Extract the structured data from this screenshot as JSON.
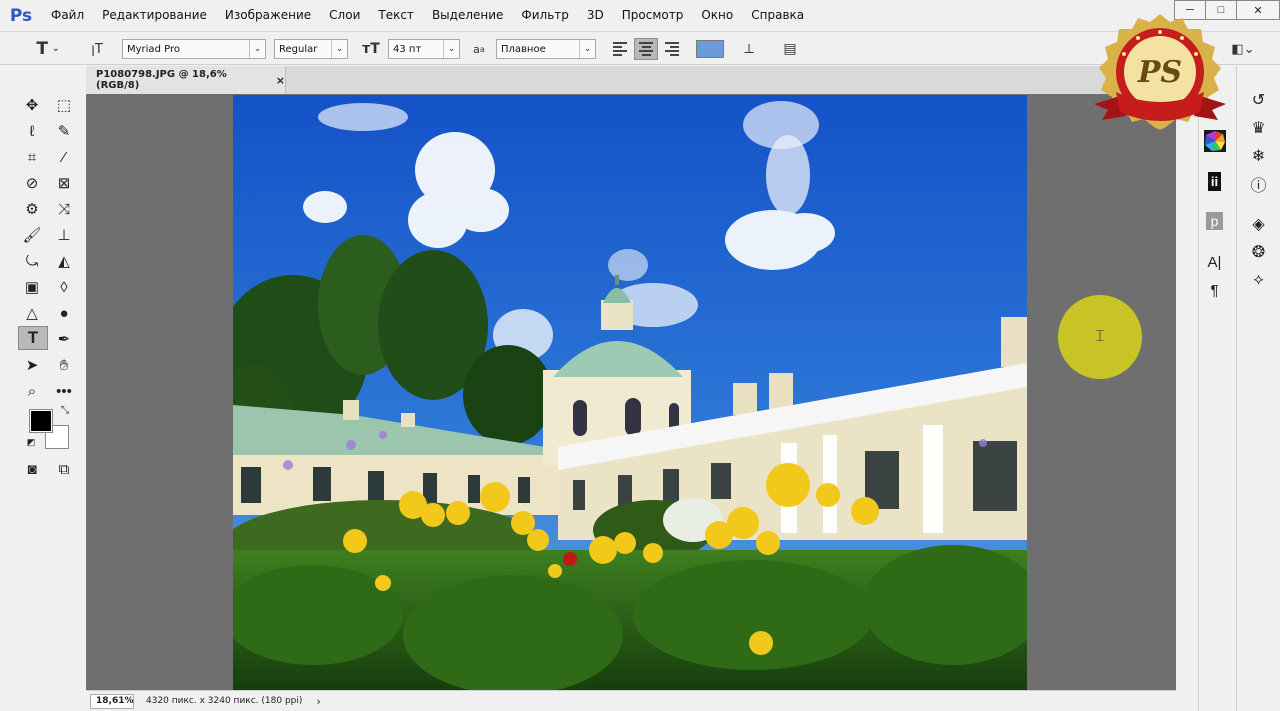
{
  "app": {
    "logo": "Ps"
  },
  "menu": [
    "Файл",
    "Редактирование",
    "Изображение",
    "Слои",
    "Текст",
    "Выделение",
    "Фильтр",
    "3D",
    "Просмотр",
    "Окно",
    "Справка"
  ],
  "options": {
    "font_family": "Myriad Pro",
    "font_style": "Regular",
    "font_size": "43 пт",
    "aa_label": "a",
    "antialias": "Плавное",
    "text_color": "#6d9bd6"
  },
  "document": {
    "tab_title": "P1080798.JPG @ 18,6% (RGB/8)",
    "tab_close": "×",
    "zoom": "18,61%",
    "status_info": "4320 пикс. x 3240 пикс. (180 ppi)",
    "status_arrow": "›"
  },
  "badge": {
    "text": "PS"
  },
  "colors": {
    "foreground": "#000000",
    "background": "#ffffff",
    "accent": "#c8c426"
  }
}
